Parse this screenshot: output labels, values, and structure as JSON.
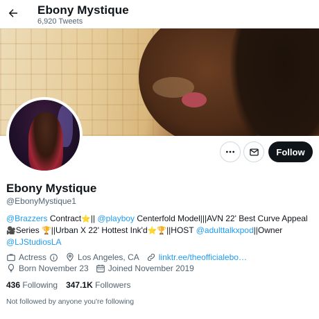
{
  "header": {
    "back_icon": "arrow-left-icon",
    "name": "Ebony Mystique",
    "tweet_count": "6,920 Tweets"
  },
  "profile": {
    "display_name": "Ebony Mystique",
    "handle": "@EbonyMystique1",
    "banner_image": "banner-photo",
    "avatar_image": "avatar-photo"
  },
  "actions": {
    "more_icon": "more-horizontal-icon",
    "message_icon": "envelope-icon",
    "follow_label": "Follow"
  },
  "bio": {
    "m1": "@Brazzers",
    "t1": " Contract",
    "e1": "⭐",
    "t2": "|| ",
    "m2": "@playboy",
    "t3": " Centerfold Model|||AVN 22' Best Curve Appeal ",
    "e2": "🎥",
    "t4": "Series ",
    "e3": "🏆",
    "t5": "||Urban X 22' Hottest Ink'd",
    "e4": "⭐",
    "e5": "🏆",
    "t6": "||HOST ",
    "m3": "@adulttalkxpod",
    "t7": "||Owner ",
    "m4": "@LJStudiosLA"
  },
  "meta": {
    "category": "Actress",
    "category_icon": "briefcase-icon",
    "info_icon": "info-icon",
    "location": "Los Angeles, CA",
    "location_icon": "location-pin-icon",
    "link": "linktr.ee/theofficialebo…",
    "link_icon": "link-icon",
    "born": "Born November 23",
    "born_icon": "balloon-icon",
    "joined": "Joined November 2019",
    "joined_icon": "calendar-icon"
  },
  "stats": {
    "following_count": "436",
    "following_label": "Following",
    "followers_count": "347.1K",
    "followers_label": "Followers"
  },
  "footer": {
    "not_followed": "Not followed by anyone you're following"
  },
  "colors": {
    "accent": "#1d9bf0",
    "text": "#0f1419",
    "secondary": "#536471",
    "follow_bg": "#0f1419"
  }
}
